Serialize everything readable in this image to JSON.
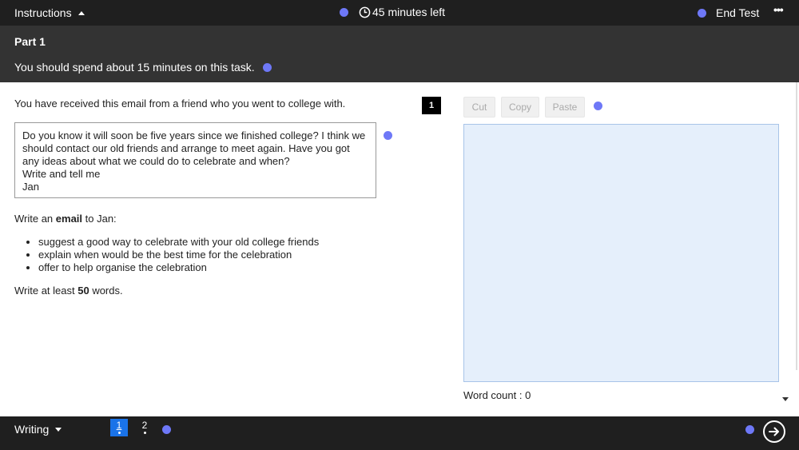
{
  "header": {
    "instructions_label": "Instructions",
    "timer_text": "45 minutes left",
    "end_test_label": "End Test",
    "more_label": "•••"
  },
  "part": {
    "title": "Part 1",
    "time_hint": "You should spend about 15 minutes on this task."
  },
  "task": {
    "intro": "You have received this email from a friend who you went to college with.",
    "email_text": "Do you know it will soon be five years since we finished college? I think we should contact our old friends and arrange to meet again. Have you got any ideas about what we could do to celebrate and when?\nWrite and tell me\nJan",
    "instruction_prefix": "Write an ",
    "instruction_bold": "email",
    "instruction_suffix": " to Jan:",
    "bullets": [
      "suggest a good way to celebrate with your old college friends",
      "explain when would be the best time for the celebration",
      "offer to help organise the celebration"
    ],
    "min_words_prefix": "Write at least ",
    "min_words_bold": "50",
    "min_words_suffix": " words."
  },
  "editor": {
    "question_number": "1",
    "cut_label": "Cut",
    "copy_label": "Copy",
    "paste_label": "Paste",
    "answer_value": "",
    "word_count_label": "Word count : 0"
  },
  "footer": {
    "section_label": "Writing",
    "questions": [
      "1",
      "2"
    ],
    "active_question": "1"
  },
  "colors": {
    "marker_dot": "#6e78f7",
    "active_tab": "#1a73e8",
    "answer_bg": "#e5effb"
  }
}
